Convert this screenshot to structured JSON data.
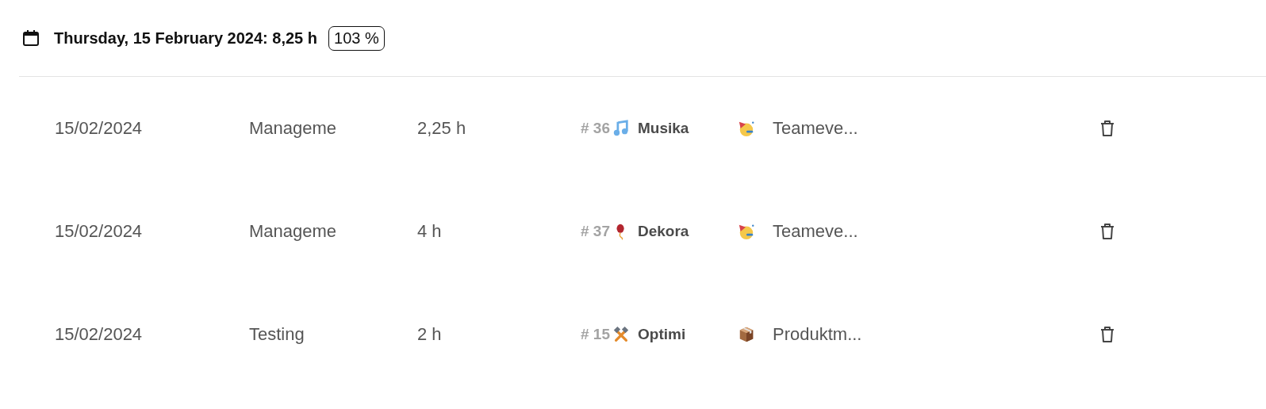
{
  "header": {
    "title": "Thursday, 15 February 2024: 8,25 h",
    "percentage": "103 %"
  },
  "entries": [
    {
      "date": "15/02/2024",
      "activity": "Manageme",
      "hours": "2,25 h",
      "ticket": {
        "number": "# 36",
        "kind": "music",
        "title": "Musika"
      },
      "project": {
        "kind": "party",
        "name": "Teameve..."
      }
    },
    {
      "date": "15/02/2024",
      "activity": "Manageme",
      "hours": "4 h",
      "ticket": {
        "number": "# 37",
        "kind": "balloon",
        "title": "Dekora"
      },
      "project": {
        "kind": "party",
        "name": "Teameve..."
      }
    },
    {
      "date": "15/02/2024",
      "activity": "Testing",
      "hours": "2 h",
      "ticket": {
        "number": "# 15",
        "kind": "tools",
        "title": "Optimi"
      },
      "project": {
        "kind": "package",
        "name": "Produktm..."
      }
    }
  ]
}
